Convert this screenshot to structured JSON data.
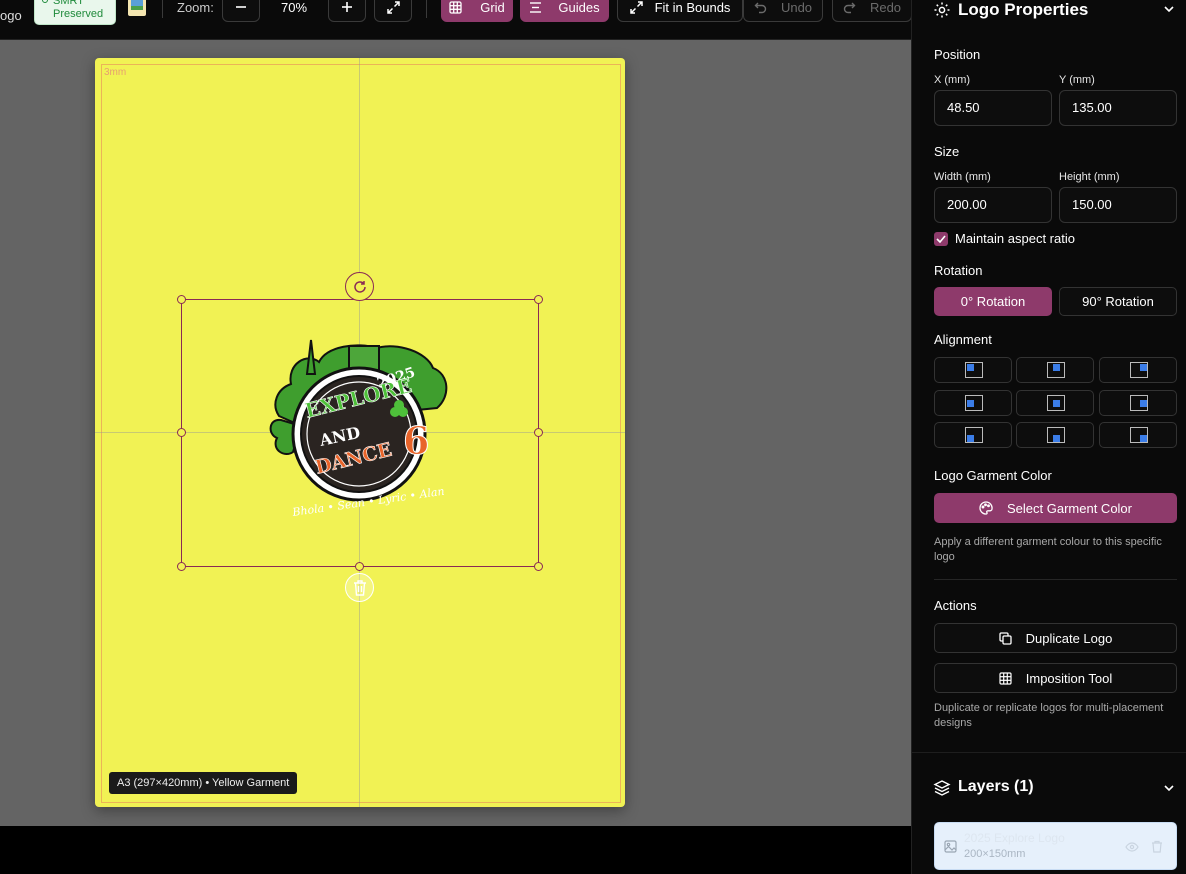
{
  "toolbar": {
    "file_label": "ogo",
    "badge_line1": "SMRT",
    "badge_line2": "Preserved",
    "zoom_label": "Zoom:",
    "zoom_value": "70%",
    "grid_label": "Grid",
    "guides_label": "Guides",
    "fit_label": "Fit in Bounds",
    "undo_label": "Undo",
    "redo_label": "Redo"
  },
  "canvas": {
    "bleed_label": "3mm",
    "garment_color": "#f1f254",
    "size_label": "A3 (297×420mm) • Yellow Garment"
  },
  "logo_art": {
    "top_text": "2025",
    "explore": "EXPLORE",
    "and": "AND",
    "dance": "DANCE",
    "number": "6",
    "script": "Bhola • Sean • Lyric • Alan"
  },
  "panel": {
    "title": "Logo Properties",
    "position": {
      "title": "Position",
      "x_label": "X (mm)",
      "x_value": "48.50",
      "y_label": "Y (mm)",
      "y_value": "135.00"
    },
    "size": {
      "title": "Size",
      "w_label": "Width (mm)",
      "w_value": "200.00",
      "h_label": "Height (mm)",
      "h_value": "150.00",
      "aspect_label": "Maintain aspect ratio",
      "aspect_checked": true
    },
    "rotation": {
      "title": "Rotation",
      "btn0": "0° Rotation",
      "btn90": "90° Rotation",
      "selected": "0° Rotation"
    },
    "alignment": {
      "title": "Alignment",
      "options": [
        "top-left",
        "top-center",
        "top-right",
        "middle-left",
        "center",
        "middle-right",
        "bottom-left",
        "bottom-center",
        "bottom-right"
      ]
    },
    "garment_color": {
      "title": "Logo Garment Color",
      "button": "Select Garment Color",
      "hint": "Apply a different garment colour to this specific logo"
    },
    "actions": {
      "title": "Actions",
      "duplicate": "Duplicate Logo",
      "imposition": "Imposition Tool",
      "hint": "Duplicate or replicate logos for multi-placement designs"
    },
    "layers": {
      "title": "Layers (1)",
      "item_name": "2025 Explore Logo",
      "item_size": "200×150mm"
    }
  },
  "colors": {
    "accent": "#8e3a6b",
    "canvas_bg": "#646464",
    "panel_bg": "#0a0a0a"
  }
}
